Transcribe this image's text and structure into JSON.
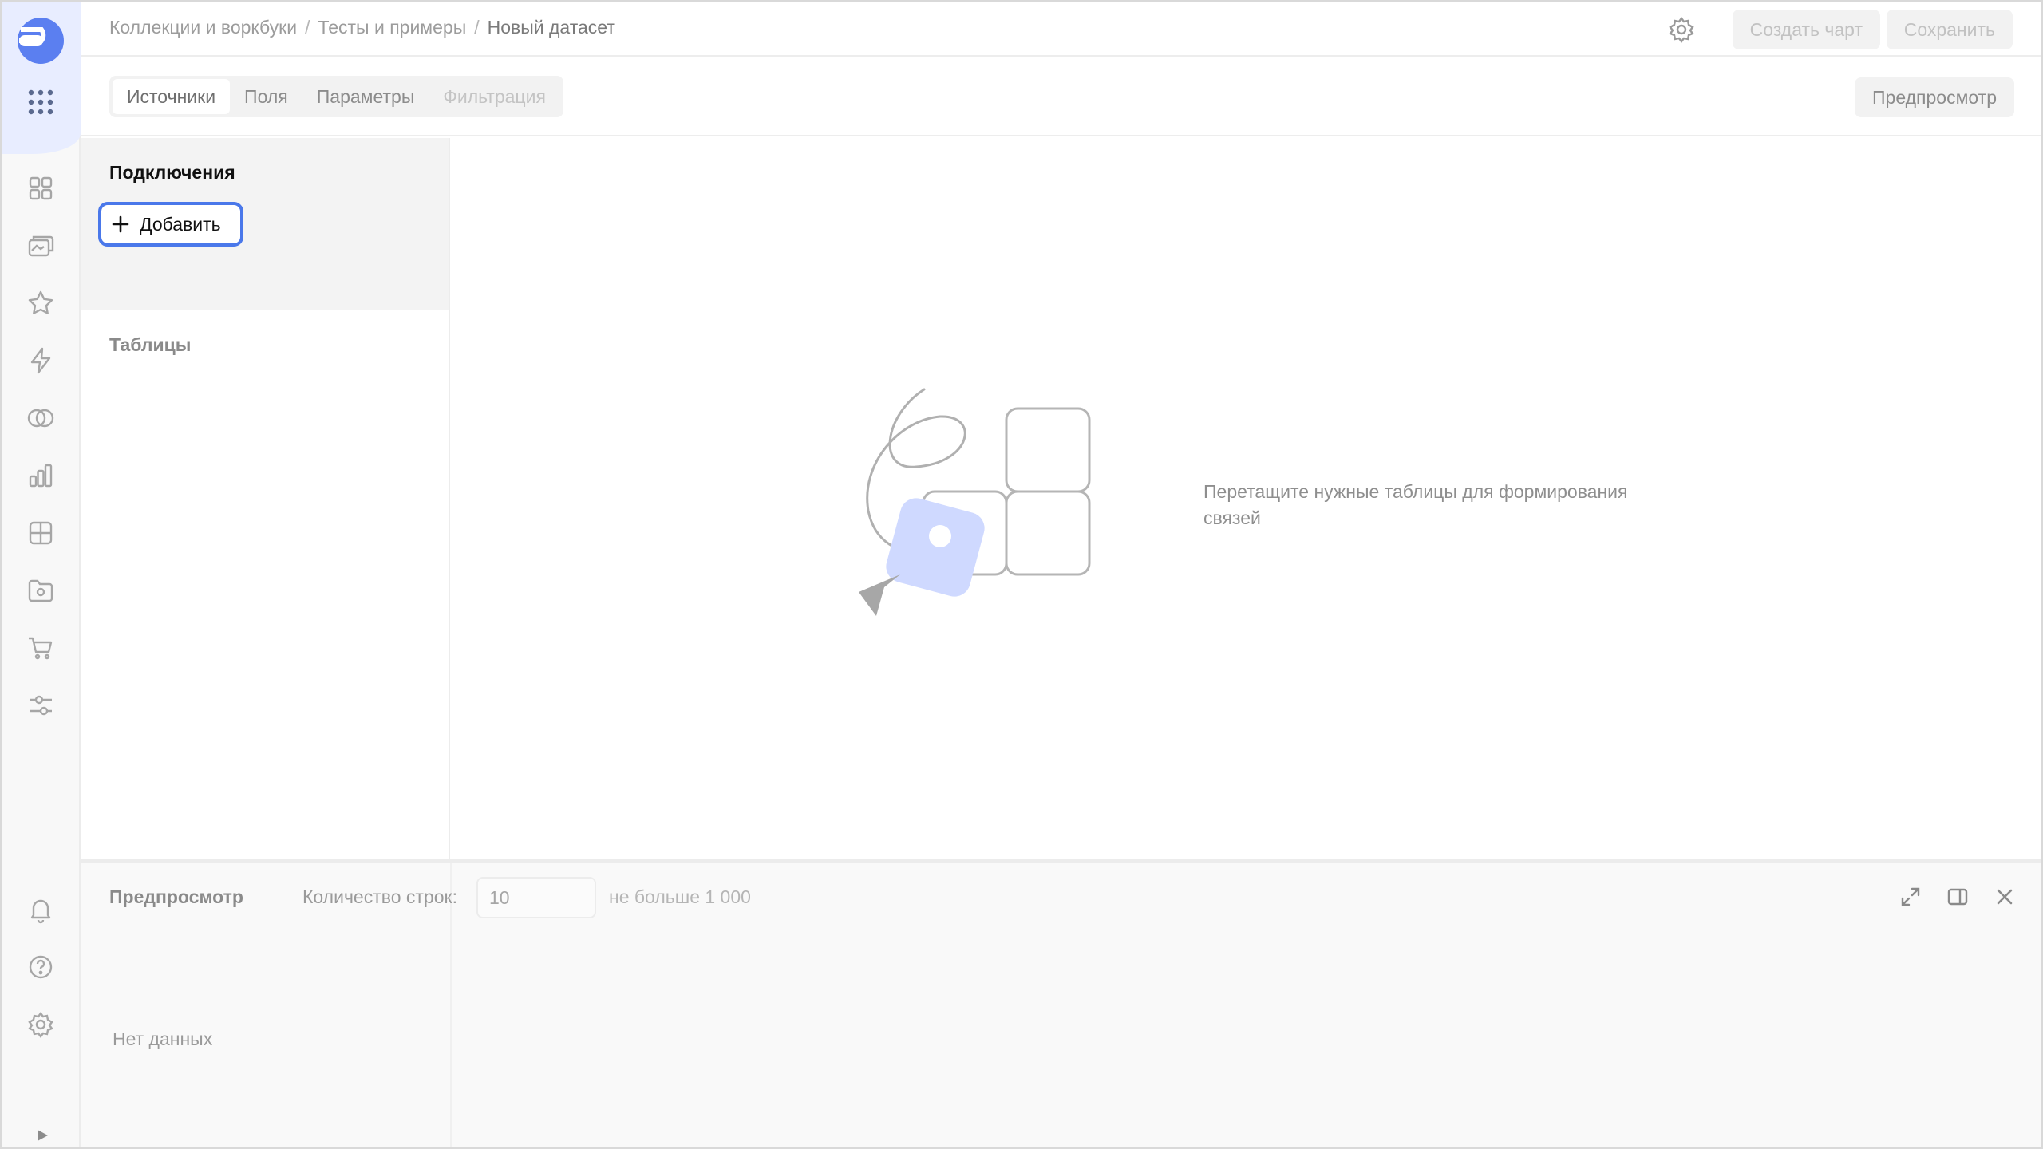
{
  "header": {
    "breadcrumb": [
      "Коллекции и воркбуки",
      "Тесты и примеры",
      "Новый датасет"
    ],
    "separator": "/",
    "create_chart_label": "Создать чарт",
    "save_label": "Сохранить"
  },
  "toolbar": {
    "tabs": [
      {
        "label": "Источники",
        "state": "active"
      },
      {
        "label": "Поля",
        "state": "normal"
      },
      {
        "label": "Параметры",
        "state": "normal"
      },
      {
        "label": "Фильтрация",
        "state": "disabled"
      }
    ],
    "preview_label": "Предпросмотр"
  },
  "sources": {
    "connections_title": "Подключения",
    "add_label": "Добавить",
    "tables_title": "Таблицы"
  },
  "workspace": {
    "hint": "Перетащите нужные таблицы для формирования связей"
  },
  "preview": {
    "title": "Предпросмотр",
    "rows_label": "Количество строк:",
    "rows_value": "10",
    "rows_limit": "не больше 1 000",
    "empty_text": "Нет данных"
  },
  "rail": {
    "icons": [
      "dashboard-grid-icon",
      "collections-icon",
      "favorites-star-icon",
      "bolt-icon",
      "connections-rings-icon",
      "charts-bar-icon",
      "datasets-table-icon",
      "workbook-folder-icon",
      "marketplace-cart-icon",
      "settings-sliders-icon",
      "bell-icon",
      "help-icon",
      "gear-icon"
    ]
  },
  "colors": {
    "accent": "#4a78ea",
    "rail_highlight": "#e8edff",
    "illustration_blue": "#cfd9ff"
  }
}
